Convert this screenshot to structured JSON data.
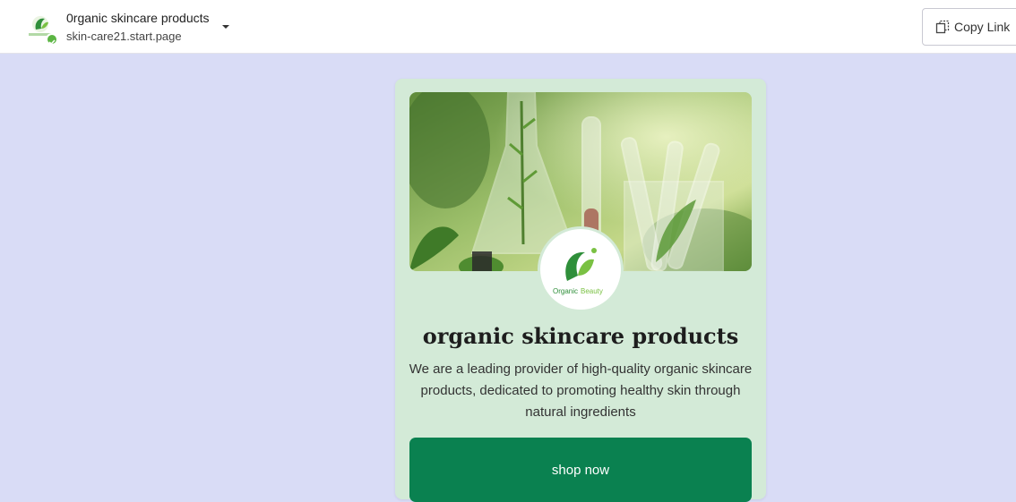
{
  "header": {
    "title": "0rganic skincare products",
    "url": "skin-care21.start.page",
    "copy_link_label": "Copy Link"
  },
  "card": {
    "logo_text_1": "Organic",
    "logo_text_2": "Beauty",
    "title": "organic skincare products",
    "description": "We are a leading provider of high-quality organic skincare products, dedicated to promoting healthy skin through natural ingredients",
    "button_label": "shop now"
  },
  "colors": {
    "page_background": "#d9dcf6",
    "card_background": "#d3ead7",
    "button": "#0a8150",
    "badge": "#5bb543"
  }
}
